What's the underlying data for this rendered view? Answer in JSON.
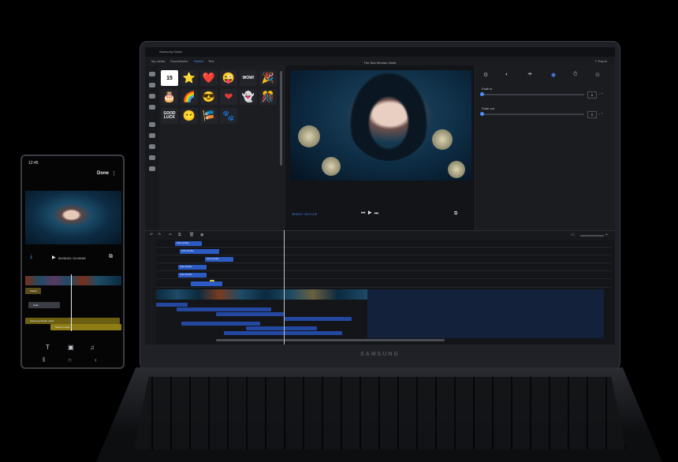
{
  "laptop": {
    "app_title": "Samsung Studio",
    "brand": "SAMSUNG",
    "project_title": "The Sea Woman Violet",
    "export_label": "Export",
    "tabs": [
      "My media",
      "Soundtracks",
      "Sticker",
      "Text"
    ],
    "active_tab": "Sticker",
    "stickers": [
      [
        "15",
        "⭐",
        "❤️",
        "😜",
        "WOW!",
        "🎉"
      ],
      [
        "🎂",
        "🌈",
        "😎",
        "❤",
        "👻",
        "🎊"
      ],
      [
        "GOOD LUCK",
        "😶",
        "🎏",
        "🐾"
      ]
    ],
    "timecode": "00:03:07 / 00:27:475",
    "effect_tabs": [
      "⚙",
      "◐",
      "☂",
      "◉",
      "⏱",
      "⊙"
    ],
    "fade_in": {
      "label": "Fade in",
      "value": "0"
    },
    "fade_out": {
      "label": "Fade out",
      "value": "0"
    },
    "text_clips": [
      "Add subtitle",
      "Add subtitle",
      "Add subtitle",
      "Add subtitle",
      "Add subtitle"
    ]
  },
  "phone": {
    "time": "12:45",
    "done_label": "Done",
    "playback_time": "00:00:00 / 01:00:00",
    "track_labels": [
      "Sticker",
      "Hello",
      "Samsung Studio music",
      "Search music"
    ]
  }
}
